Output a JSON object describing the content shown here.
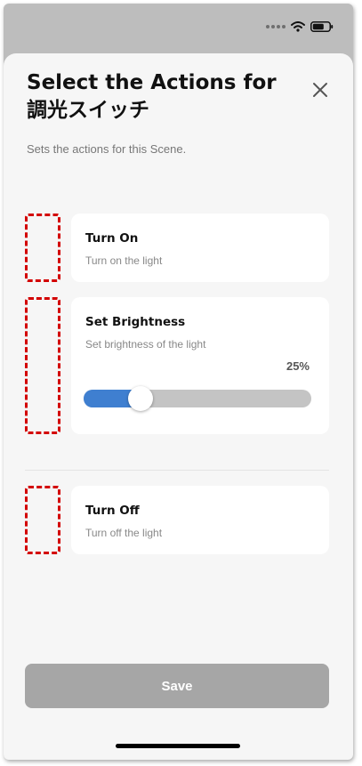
{
  "status_bar": {
    "icons": [
      "signal-dots-icon",
      "wifi-icon",
      "battery-icon"
    ]
  },
  "sheet": {
    "title_line1": "Select the Actions for",
    "title_line2": "調光スイッチ",
    "subtitle": "Sets the actions for this Scene."
  },
  "actions": [
    {
      "title": "Turn On",
      "description": "Turn on the light"
    },
    {
      "title": "Set Brightness",
      "description": "Set brightness of the light",
      "value_label": "25%",
      "value": 0.25
    },
    {
      "title": "Turn Off",
      "description": "Turn off the light"
    }
  ],
  "save_label": "Save",
  "colors": {
    "accent": "#3f7fd0",
    "placeholder_outline": "#d30000",
    "save_disabled": "#a6a6a6",
    "sheet_background": "#f6f6f6"
  }
}
